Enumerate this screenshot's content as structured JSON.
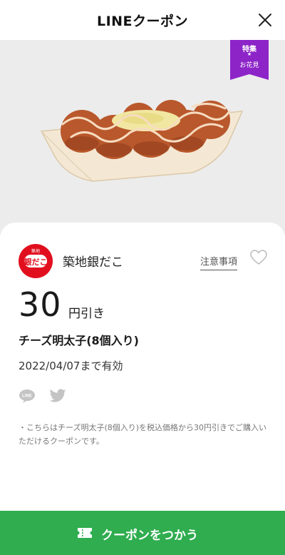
{
  "header": {
    "title": "LINEクーポン"
  },
  "hero": {
    "badge_line1": "特集",
    "badge_star": "★",
    "badge_line2": "お花見",
    "badge_color": "#8d24c8"
  },
  "brand": {
    "name": "築地銀だこ",
    "logo_text": "銀だこ",
    "logo_top": "築地"
  },
  "actions": {
    "notes_label": "注意事項"
  },
  "coupon": {
    "amount": "30",
    "unit": "円引き",
    "product": "チーズ明太子(8個入り)",
    "valid": "2022/04/07まで有効",
    "description": "・こちらはチーズ明太子(8個入り)を税込価格から30円引きでご購入いただけるクーポンです。"
  },
  "share": {
    "line_icon": "line-icon",
    "twitter_icon": "twitter-icon"
  },
  "footer": {
    "use_label": "クーポンをつかう",
    "color": "#2fad4f"
  }
}
